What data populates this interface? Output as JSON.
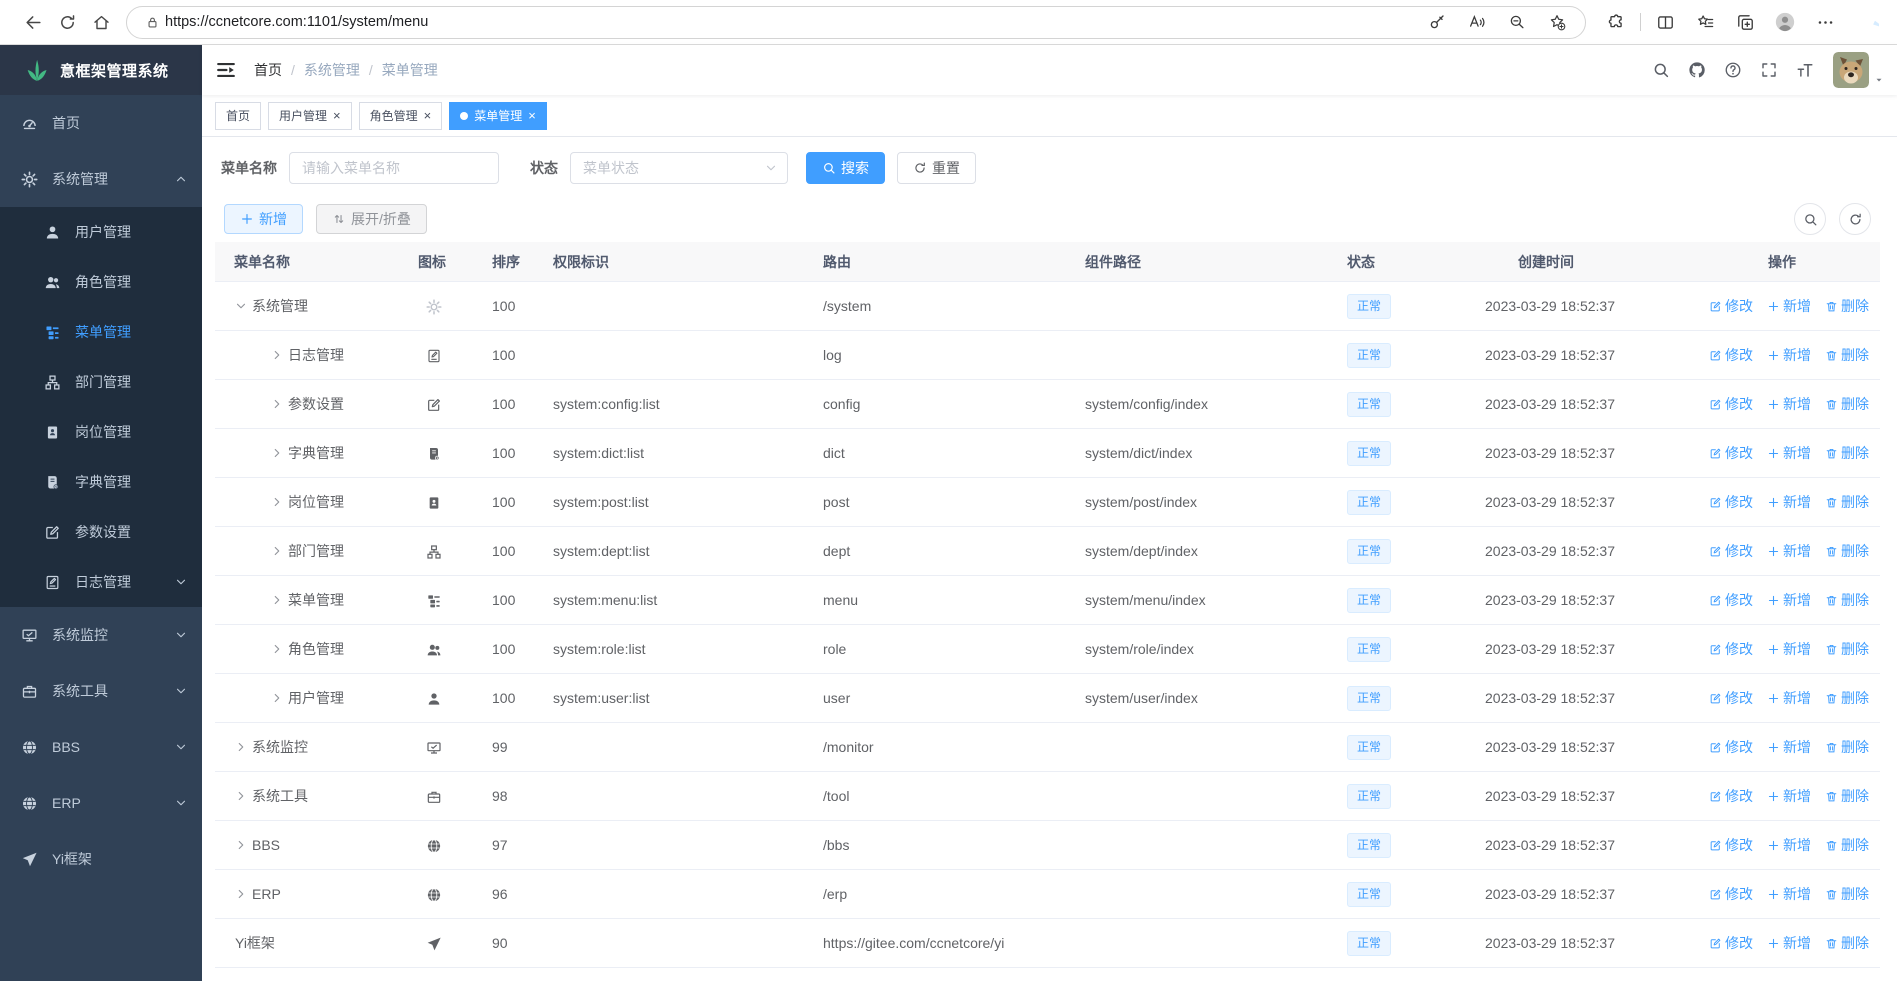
{
  "colors": {
    "accent": "#409eff",
    "sidebar_bg": "#304156",
    "sidebar_submenu_bg": "#1f2d3d",
    "sidebar_text": "#bfcbd9",
    "logo_green": "#42b983",
    "status_tag_bg": "#ecf5ff",
    "status_tag_text": "#409eff"
  },
  "browser": {
    "url": "https://ccnetcore.com:1101/system/menu",
    "left_icons": [
      "back",
      "reload",
      "home"
    ],
    "urlbar_trailing_icons": [
      "key",
      "read-aloud",
      "zoom-out",
      "favorite-star"
    ],
    "right_icons": [
      "extensions",
      "split-screen",
      "favorites",
      "collections",
      "profile",
      "more",
      "copilot"
    ]
  },
  "sidebar": {
    "logo_text": "意框架管理系统",
    "items": [
      {
        "label": "首页",
        "icon": "dash",
        "type": "top"
      },
      {
        "label": "系统管理",
        "icon": "gear",
        "type": "top",
        "chevron": "up"
      },
      {
        "label": "用户管理",
        "icon": "user",
        "type": "sub"
      },
      {
        "label": "角色管理",
        "icon": "users",
        "type": "sub"
      },
      {
        "label": "菜单管理",
        "icon": "list",
        "type": "sub",
        "active": true
      },
      {
        "label": "部门管理",
        "icon": "tree",
        "type": "sub"
      },
      {
        "label": "岗位管理",
        "icon": "post",
        "type": "sub"
      },
      {
        "label": "字典管理",
        "icon": "dict",
        "type": "sub"
      },
      {
        "label": "参数设置",
        "icon": "edit",
        "type": "sub"
      },
      {
        "label": "日志管理",
        "icon": "log",
        "type": "sub",
        "chevron": "down"
      },
      {
        "label": "系统监控",
        "icon": "monitor",
        "type": "top",
        "chevron": "down"
      },
      {
        "label": "系统工具",
        "icon": "tool",
        "type": "top",
        "chevron": "down"
      },
      {
        "label": "BBS",
        "icon": "globe",
        "type": "top",
        "chevron": "down"
      },
      {
        "label": "ERP",
        "icon": "globe",
        "type": "top",
        "chevron": "down"
      },
      {
        "label": "Yi框架",
        "icon": "send",
        "type": "top"
      }
    ]
  },
  "navbar": {
    "breadcrumb": [
      "首页",
      "系统管理",
      "菜单管理"
    ],
    "separator": "/",
    "icons": [
      "search",
      "github",
      "help",
      "fullscreen",
      "font-size"
    ]
  },
  "tags": {
    "close_glyph": "×",
    "items": [
      {
        "label": "首页",
        "closable": false,
        "active": false
      },
      {
        "label": "用户管理",
        "closable": true,
        "active": false
      },
      {
        "label": "角色管理",
        "closable": true,
        "active": false
      },
      {
        "label": "菜单管理",
        "closable": true,
        "active": true
      }
    ]
  },
  "filters": {
    "name_label": "菜单名称",
    "name_placeholder": "请输入菜单名称",
    "status_label": "状态",
    "status_placeholder": "菜单状态",
    "search_label": "搜索",
    "reset_label": "重置"
  },
  "toolbar": {
    "add_label": "新增",
    "expand_label": "展开/折叠"
  },
  "table": {
    "columns": [
      "菜单名称",
      "图标",
      "排序",
      "权限标识",
      "路由",
      "组件路径",
      "状态",
      "创建时间",
      "操作"
    ],
    "actions": [
      "修改",
      "新增",
      "删除"
    ],
    "rows": [
      {
        "name": "系统管理",
        "icon": "gear",
        "level": 0,
        "expander": "down",
        "order": "100",
        "perms": "",
        "path": "/system",
        "component": "",
        "status": "正常",
        "created": "2023-03-29 18:52:37"
      },
      {
        "name": "日志管理",
        "icon": "log",
        "level": 1,
        "expander": "right",
        "order": "100",
        "perms": "",
        "path": "log",
        "component": "",
        "status": "正常",
        "created": "2023-03-29 18:52:37"
      },
      {
        "name": "参数设置",
        "icon": "edit",
        "level": 1,
        "expander": "right",
        "order": "100",
        "perms": "system:config:list",
        "path": "config",
        "component": "system/config/index",
        "status": "正常",
        "created": "2023-03-29 18:52:37"
      },
      {
        "name": "字典管理",
        "icon": "dict",
        "level": 1,
        "expander": "right",
        "order": "100",
        "perms": "system:dict:list",
        "path": "dict",
        "component": "system/dict/index",
        "status": "正常",
        "created": "2023-03-29 18:52:37"
      },
      {
        "name": "岗位管理",
        "icon": "post",
        "level": 1,
        "expander": "right",
        "order": "100",
        "perms": "system:post:list",
        "path": "post",
        "component": "system/post/index",
        "status": "正常",
        "created": "2023-03-29 18:52:37"
      },
      {
        "name": "部门管理",
        "icon": "tree",
        "level": 1,
        "expander": "right",
        "order": "100",
        "perms": "system:dept:list",
        "path": "dept",
        "component": "system/dept/index",
        "status": "正常",
        "created": "2023-03-29 18:52:37"
      },
      {
        "name": "菜单管理",
        "icon": "list",
        "level": 1,
        "expander": "right",
        "order": "100",
        "perms": "system:menu:list",
        "path": "menu",
        "component": "system/menu/index",
        "status": "正常",
        "created": "2023-03-29 18:52:37"
      },
      {
        "name": "角色管理",
        "icon": "users",
        "level": 1,
        "expander": "right",
        "order": "100",
        "perms": "system:role:list",
        "path": "role",
        "component": "system/role/index",
        "status": "正常",
        "created": "2023-03-29 18:52:37"
      },
      {
        "name": "用户管理",
        "icon": "user",
        "level": 1,
        "expander": "right",
        "order": "100",
        "perms": "system:user:list",
        "path": "user",
        "component": "system/user/index",
        "status": "正常",
        "created": "2023-03-29 18:52:37"
      },
      {
        "name": "系统监控",
        "icon": "monitor",
        "level": 0,
        "expander": "right",
        "order": "99",
        "perms": "",
        "path": "/monitor",
        "component": "",
        "status": "正常",
        "created": "2023-03-29 18:52:37"
      },
      {
        "name": "系统工具",
        "icon": "tool",
        "level": 0,
        "expander": "right",
        "order": "98",
        "perms": "",
        "path": "/tool",
        "component": "",
        "status": "正常",
        "created": "2023-03-29 18:52:37"
      },
      {
        "name": "BBS",
        "icon": "globe",
        "level": 0,
        "expander": "right",
        "order": "97",
        "perms": "",
        "path": "/bbs",
        "component": "",
        "status": "正常",
        "created": "2023-03-29 18:52:37"
      },
      {
        "name": "ERP",
        "icon": "globe",
        "level": 0,
        "expander": "right",
        "order": "96",
        "perms": "",
        "path": "/erp",
        "component": "",
        "status": "正常",
        "created": "2023-03-29 18:52:37"
      },
      {
        "name": "Yi框架",
        "icon": "send",
        "level": 0,
        "expander": "none",
        "order": "90",
        "perms": "",
        "path": "https://gitee.com/ccnetcore/yi",
        "component": "",
        "status": "正常",
        "created": "2023-03-29 18:52:37"
      }
    ]
  }
}
